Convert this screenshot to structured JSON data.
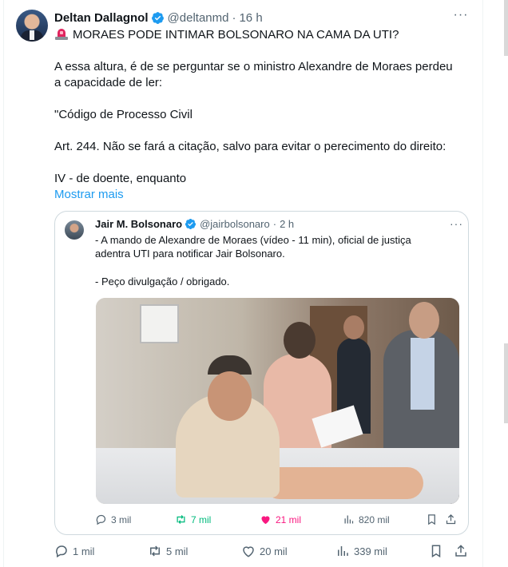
{
  "tweet": {
    "author_name": "Deltan Dallagnol",
    "handle": "@deltanmd",
    "separator": "·",
    "time": "16 h",
    "more_label": "···",
    "headline": "MORAES PODE INTIMAR BOLSONARO NA CAMA DA UTI?",
    "paragraph1_line1": "A essa altura, é de se perguntar se o ministro Alexandre de Moraes perdeu",
    "paragraph1_line2": "a capacidade de ler:",
    "paragraph2": "\"Código de Processo Civil",
    "paragraph3": "Art. 244. Não se fará a citação, salvo para evitar o perecimento do direito:",
    "paragraph4": "IV - de doente, enquanto",
    "show_more": "Mostrar mais",
    "actions": {
      "replies": "1 mil",
      "retweets": "5 mil",
      "likes": "20 mil",
      "views": "339 mil"
    }
  },
  "quote": {
    "author_name": "Jair M. Bolsonaro",
    "handle": "@jairbolsonaro",
    "separator": "·",
    "time": "2 h",
    "more_label": "···",
    "line1": "- A mando de Alexandre de Moraes (vídeo - 11 min), oficial de justiça",
    "line2": "adentra UTI para notificar Jair Bolsonaro.",
    "line3": "- Peço divulgação / obrigado.",
    "actions": {
      "replies": "3 mil",
      "retweets": "7 mil",
      "likes": "21 mil",
      "views": "820 mil"
    }
  },
  "colors": {
    "accent": "#1d9bf0",
    "retweet_green": "#00ba7c",
    "like_pink": "#f91880",
    "muted": "#536471"
  },
  "icons": [
    "verified-badge-icon",
    "siren-icon",
    "more-icon",
    "reply-icon",
    "retweet-icon",
    "like-icon",
    "views-icon",
    "bookmark-icon",
    "share-icon"
  ]
}
